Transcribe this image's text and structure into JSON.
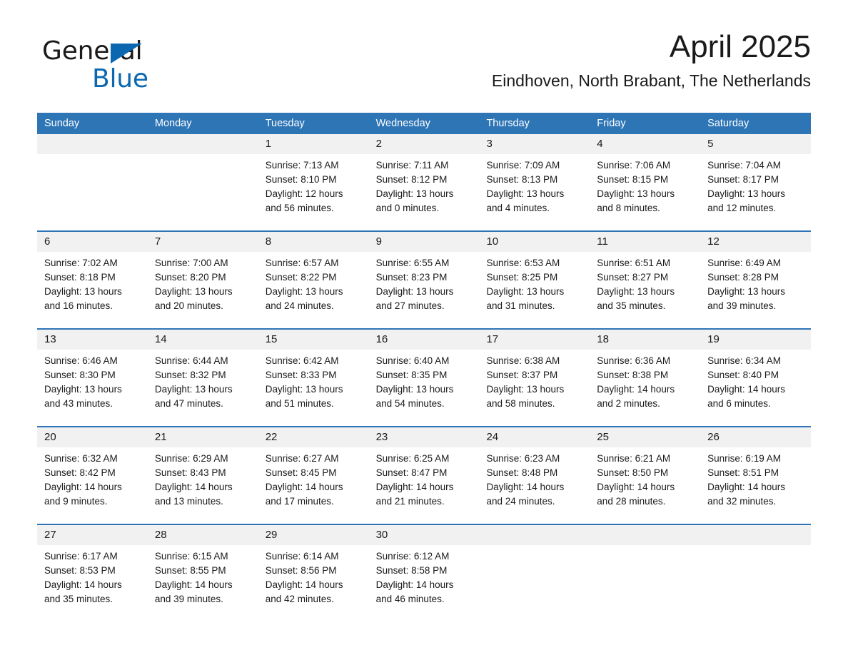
{
  "logo": {
    "word_one": "General",
    "word_two": "Blue",
    "triangle_color": "#0b68b0"
  },
  "header": {
    "title": "April 2025",
    "subtitle": "Eindhoven, North Brabant, The Netherlands"
  },
  "theme": {
    "header_blue": "#2e75b6",
    "daynum_band": "#f1f1f1",
    "text": "#1a1a1a",
    "logo_blue": "#0b68b0"
  },
  "weekday_headers": [
    "Sunday",
    "Monday",
    "Tuesday",
    "Wednesday",
    "Thursday",
    "Friday",
    "Saturday"
  ],
  "weeks": [
    [
      {
        "day": "",
        "sunrise": "",
        "sunset": "",
        "daylight_line1": "",
        "daylight_line2": ""
      },
      {
        "day": "",
        "sunrise": "",
        "sunset": "",
        "daylight_line1": "",
        "daylight_line2": ""
      },
      {
        "day": "1",
        "sunrise": "Sunrise: 7:13 AM",
        "sunset": "Sunset: 8:10 PM",
        "daylight_line1": "Daylight: 12 hours",
        "daylight_line2": "and 56 minutes."
      },
      {
        "day": "2",
        "sunrise": "Sunrise: 7:11 AM",
        "sunset": "Sunset: 8:12 PM",
        "daylight_line1": "Daylight: 13 hours",
        "daylight_line2": "and 0 minutes."
      },
      {
        "day": "3",
        "sunrise": "Sunrise: 7:09 AM",
        "sunset": "Sunset: 8:13 PM",
        "daylight_line1": "Daylight: 13 hours",
        "daylight_line2": "and 4 minutes."
      },
      {
        "day": "4",
        "sunrise": "Sunrise: 7:06 AM",
        "sunset": "Sunset: 8:15 PM",
        "daylight_line1": "Daylight: 13 hours",
        "daylight_line2": "and 8 minutes."
      },
      {
        "day": "5",
        "sunrise": "Sunrise: 7:04 AM",
        "sunset": "Sunset: 8:17 PM",
        "daylight_line1": "Daylight: 13 hours",
        "daylight_line2": "and 12 minutes."
      }
    ],
    [
      {
        "day": "6",
        "sunrise": "Sunrise: 7:02 AM",
        "sunset": "Sunset: 8:18 PM",
        "daylight_line1": "Daylight: 13 hours",
        "daylight_line2": "and 16 minutes."
      },
      {
        "day": "7",
        "sunrise": "Sunrise: 7:00 AM",
        "sunset": "Sunset: 8:20 PM",
        "daylight_line1": "Daylight: 13 hours",
        "daylight_line2": "and 20 minutes."
      },
      {
        "day": "8",
        "sunrise": "Sunrise: 6:57 AM",
        "sunset": "Sunset: 8:22 PM",
        "daylight_line1": "Daylight: 13 hours",
        "daylight_line2": "and 24 minutes."
      },
      {
        "day": "9",
        "sunrise": "Sunrise: 6:55 AM",
        "sunset": "Sunset: 8:23 PM",
        "daylight_line1": "Daylight: 13 hours",
        "daylight_line2": "and 27 minutes."
      },
      {
        "day": "10",
        "sunrise": "Sunrise: 6:53 AM",
        "sunset": "Sunset: 8:25 PM",
        "daylight_line1": "Daylight: 13 hours",
        "daylight_line2": "and 31 minutes."
      },
      {
        "day": "11",
        "sunrise": "Sunrise: 6:51 AM",
        "sunset": "Sunset: 8:27 PM",
        "daylight_line1": "Daylight: 13 hours",
        "daylight_line2": "and 35 minutes."
      },
      {
        "day": "12",
        "sunrise": "Sunrise: 6:49 AM",
        "sunset": "Sunset: 8:28 PM",
        "daylight_line1": "Daylight: 13 hours",
        "daylight_line2": "and 39 minutes."
      }
    ],
    [
      {
        "day": "13",
        "sunrise": "Sunrise: 6:46 AM",
        "sunset": "Sunset: 8:30 PM",
        "daylight_line1": "Daylight: 13 hours",
        "daylight_line2": "and 43 minutes."
      },
      {
        "day": "14",
        "sunrise": "Sunrise: 6:44 AM",
        "sunset": "Sunset: 8:32 PM",
        "daylight_line1": "Daylight: 13 hours",
        "daylight_line2": "and 47 minutes."
      },
      {
        "day": "15",
        "sunrise": "Sunrise: 6:42 AM",
        "sunset": "Sunset: 8:33 PM",
        "daylight_line1": "Daylight: 13 hours",
        "daylight_line2": "and 51 minutes."
      },
      {
        "day": "16",
        "sunrise": "Sunrise: 6:40 AM",
        "sunset": "Sunset: 8:35 PM",
        "daylight_line1": "Daylight: 13 hours",
        "daylight_line2": "and 54 minutes."
      },
      {
        "day": "17",
        "sunrise": "Sunrise: 6:38 AM",
        "sunset": "Sunset: 8:37 PM",
        "daylight_line1": "Daylight: 13 hours",
        "daylight_line2": "and 58 minutes."
      },
      {
        "day": "18",
        "sunrise": "Sunrise: 6:36 AM",
        "sunset": "Sunset: 8:38 PM",
        "daylight_line1": "Daylight: 14 hours",
        "daylight_line2": "and 2 minutes."
      },
      {
        "day": "19",
        "sunrise": "Sunrise: 6:34 AM",
        "sunset": "Sunset: 8:40 PM",
        "daylight_line1": "Daylight: 14 hours",
        "daylight_line2": "and 6 minutes."
      }
    ],
    [
      {
        "day": "20",
        "sunrise": "Sunrise: 6:32 AM",
        "sunset": "Sunset: 8:42 PM",
        "daylight_line1": "Daylight: 14 hours",
        "daylight_line2": "and 9 minutes."
      },
      {
        "day": "21",
        "sunrise": "Sunrise: 6:29 AM",
        "sunset": "Sunset: 8:43 PM",
        "daylight_line1": "Daylight: 14 hours",
        "daylight_line2": "and 13 minutes."
      },
      {
        "day": "22",
        "sunrise": "Sunrise: 6:27 AM",
        "sunset": "Sunset: 8:45 PM",
        "daylight_line1": "Daylight: 14 hours",
        "daylight_line2": "and 17 minutes."
      },
      {
        "day": "23",
        "sunrise": "Sunrise: 6:25 AM",
        "sunset": "Sunset: 8:47 PM",
        "daylight_line1": "Daylight: 14 hours",
        "daylight_line2": "and 21 minutes."
      },
      {
        "day": "24",
        "sunrise": "Sunrise: 6:23 AM",
        "sunset": "Sunset: 8:48 PM",
        "daylight_line1": "Daylight: 14 hours",
        "daylight_line2": "and 24 minutes."
      },
      {
        "day": "25",
        "sunrise": "Sunrise: 6:21 AM",
        "sunset": "Sunset: 8:50 PM",
        "daylight_line1": "Daylight: 14 hours",
        "daylight_line2": "and 28 minutes."
      },
      {
        "day": "26",
        "sunrise": "Sunrise: 6:19 AM",
        "sunset": "Sunset: 8:51 PM",
        "daylight_line1": "Daylight: 14 hours",
        "daylight_line2": "and 32 minutes."
      }
    ],
    [
      {
        "day": "27",
        "sunrise": "Sunrise: 6:17 AM",
        "sunset": "Sunset: 8:53 PM",
        "daylight_line1": "Daylight: 14 hours",
        "daylight_line2": "and 35 minutes."
      },
      {
        "day": "28",
        "sunrise": "Sunrise: 6:15 AM",
        "sunset": "Sunset: 8:55 PM",
        "daylight_line1": "Daylight: 14 hours",
        "daylight_line2": "and 39 minutes."
      },
      {
        "day": "29",
        "sunrise": "Sunrise: 6:14 AM",
        "sunset": "Sunset: 8:56 PM",
        "daylight_line1": "Daylight: 14 hours",
        "daylight_line2": "and 42 minutes."
      },
      {
        "day": "30",
        "sunrise": "Sunrise: 6:12 AM",
        "sunset": "Sunset: 8:58 PM",
        "daylight_line1": "Daylight: 14 hours",
        "daylight_line2": "and 46 minutes."
      },
      {
        "day": "",
        "sunrise": "",
        "sunset": "",
        "daylight_line1": "",
        "daylight_line2": ""
      },
      {
        "day": "",
        "sunrise": "",
        "sunset": "",
        "daylight_line1": "",
        "daylight_line2": ""
      },
      {
        "day": "",
        "sunrise": "",
        "sunset": "",
        "daylight_line1": "",
        "daylight_line2": ""
      }
    ]
  ]
}
